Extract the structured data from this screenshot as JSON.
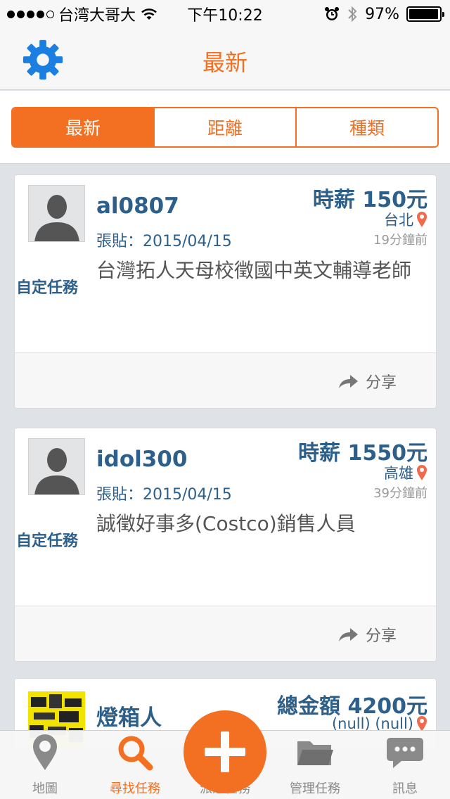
{
  "status_bar": {
    "carrier": "台湾大哥大",
    "time": "下午10:22",
    "battery": "97%",
    "battery_level": 0.97
  },
  "nav": {
    "title": "最新",
    "settings_icon": "gear-icon"
  },
  "segments": [
    {
      "label": "最新",
      "active": true
    },
    {
      "label": "距離",
      "active": false
    },
    {
      "label": "種類",
      "active": false
    }
  ],
  "posts": [
    {
      "username": "al0807",
      "posted": "張貼：2015/04/15",
      "wage": "時薪 150元",
      "location": "台北",
      "ago": "19分鐘前",
      "category": "自定任務",
      "title": "台灣拓人天母校徵國中英文輔導老師",
      "share_label": "分享"
    },
    {
      "username": "idol300",
      "posted": "張貼：2015/04/15",
      "wage": "時薪 1550元",
      "location": "高雄",
      "ago": "39分鐘前",
      "category": "自定任務",
      "title": "誠徵好事多(Costco)銷售人員",
      "share_label": "分享"
    },
    {
      "username": "燈箱人",
      "wage": "總金額 4200元",
      "location": "(null) (null)"
    }
  ],
  "tab_bar": {
    "items": [
      {
        "label": "地圖",
        "icon": "map-pin-icon",
        "active": false
      },
      {
        "label": "尋找任務",
        "icon": "search-icon",
        "active": true
      },
      {
        "label": "派遣任務",
        "icon": "plus-icon",
        "active": false
      },
      {
        "label": "管理任務",
        "icon": "folder-icon",
        "active": false
      },
      {
        "label": "訊息",
        "icon": "chat-bubble-icon",
        "active": false
      }
    ]
  },
  "colors": {
    "accent": "#f36f21",
    "text_blue": "#2d5f8b",
    "pin": "#f26a4b",
    "background": "#dfe2e6"
  }
}
